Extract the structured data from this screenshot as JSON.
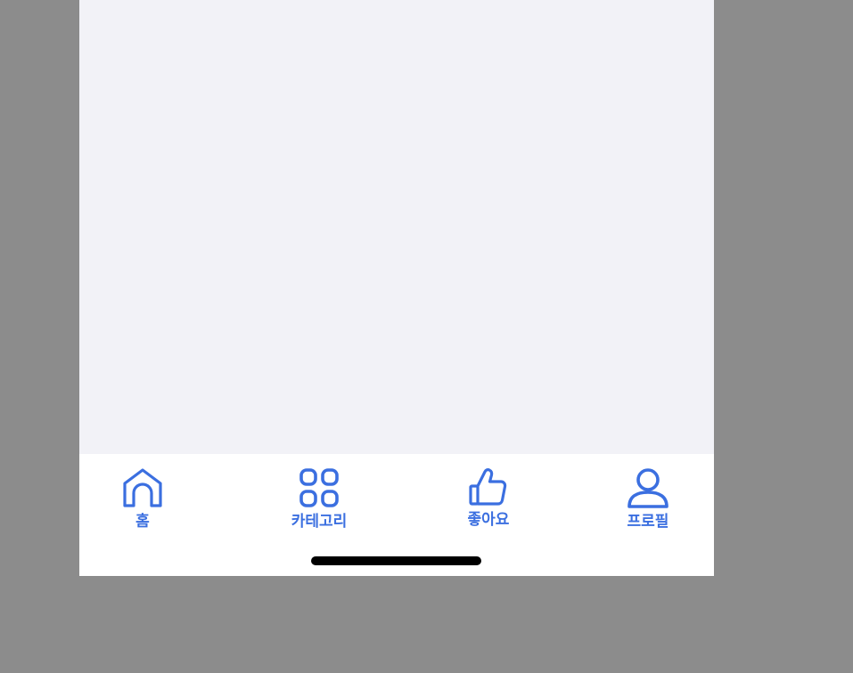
{
  "colors": {
    "accent": "#3b6fe0",
    "tab_bar_background": "#ffffff",
    "content_background": "#f2f2f7",
    "outer_background": "#8c8c8c",
    "home_indicator": "#000000"
  },
  "tab_bar": {
    "items": [
      {
        "label": "홈",
        "icon": "home-icon"
      },
      {
        "label": "카테고리",
        "icon": "grid-icon"
      },
      {
        "label": "좋아요",
        "icon": "thumbs-up-icon"
      },
      {
        "label": "프로필",
        "icon": "person-icon"
      }
    ]
  }
}
